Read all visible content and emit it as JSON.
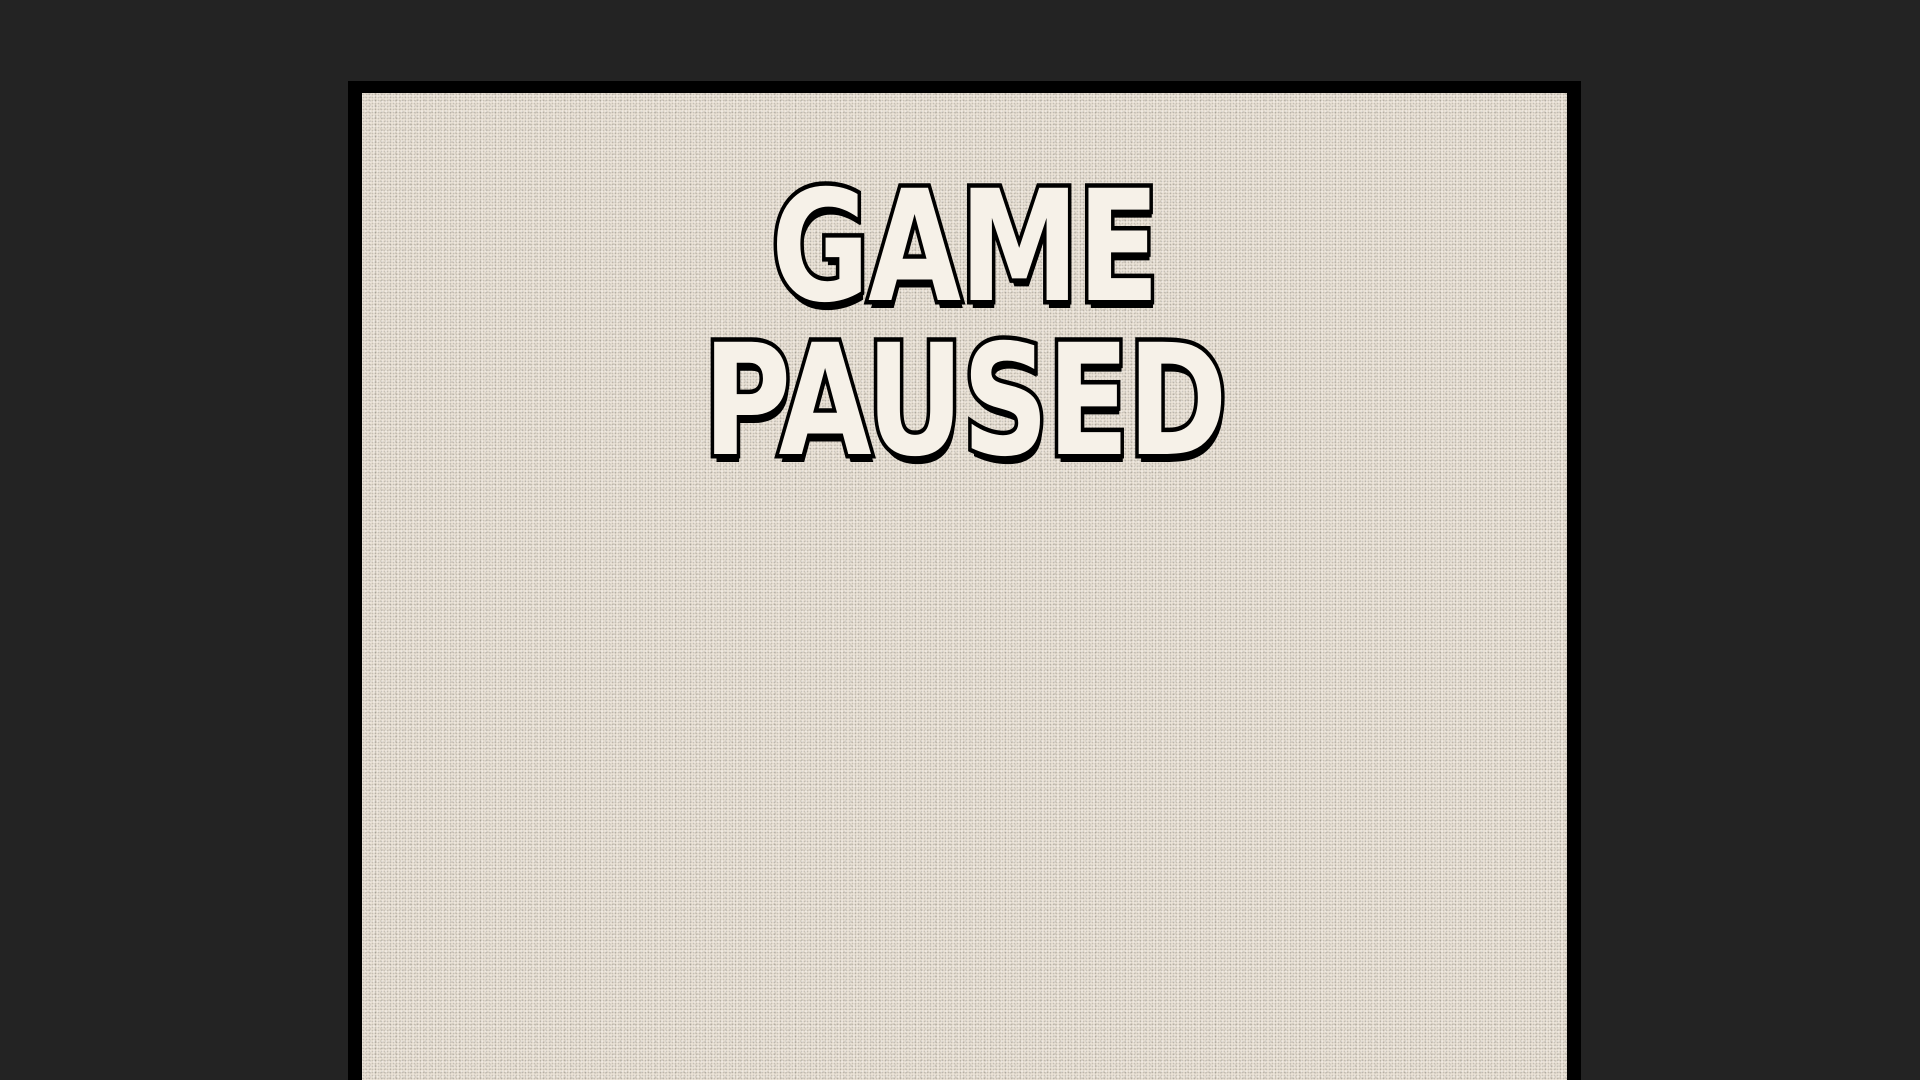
{
  "pause_menu": {
    "title": "GAME PAUSED"
  },
  "colors": {
    "backdrop": "#232323",
    "frame": "#000000",
    "panel": "#ece4d8",
    "title_fill": "#f6f1e8",
    "title_outline": "#000000"
  }
}
